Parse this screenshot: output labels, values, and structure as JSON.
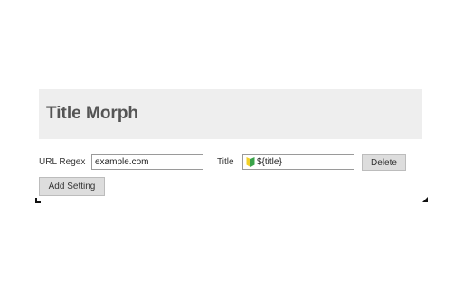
{
  "header": {
    "title": "Title Morph"
  },
  "setting_row": {
    "url_regex_label": "URL Regex",
    "url_regex_value": "example.com",
    "title_label": "Title",
    "title_value": "${title}",
    "title_icon": "beginner-mark-icon",
    "delete_label": "Delete"
  },
  "actions": {
    "add_setting_label": "Add Setting"
  },
  "colors": {
    "header_bg": "#eeeeee",
    "button_bg": "#dddddd",
    "icon_green": "#3aa34a",
    "icon_yellow": "#f2d027"
  }
}
